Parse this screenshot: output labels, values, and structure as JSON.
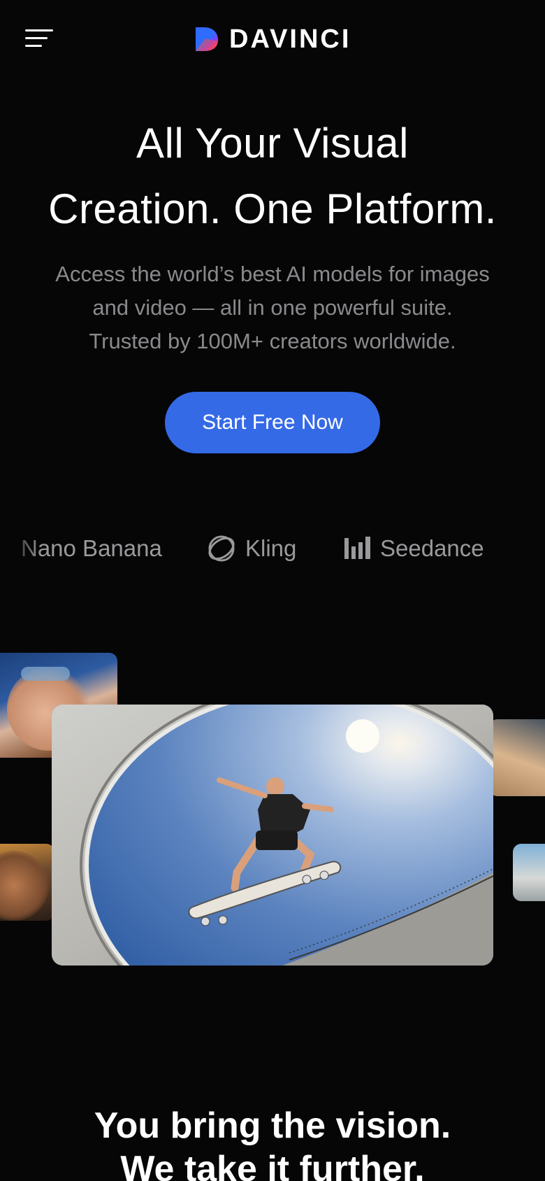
{
  "header": {
    "menu_icon": "hamburger-menu-icon",
    "logo_icon": "davinci-logo-icon",
    "logo_text": "DAVINCI"
  },
  "hero": {
    "title_line1": "All Your Visual",
    "title_line2": "Creation. One Platform.",
    "subtitle_line1": "Access the world’s best AI models for images",
    "subtitle_line2": "and video — all in one powerful suite.",
    "subtitle_line3": "Trusted by 100M+ creators worldwide.",
    "cta_label": "Start Free Now"
  },
  "models": [
    {
      "name": "Nano Banana",
      "icon": null
    },
    {
      "name": "Kling",
      "icon": "kling-logo-icon"
    },
    {
      "name": "Seedance",
      "icon": "seedance-bars-icon"
    }
  ],
  "gallery": {
    "main_image": "skateboarder-in-bowl-photo",
    "side_images": [
      "woman-sunglasses-photo",
      "man-laughing-photo",
      "woman-field-photo",
      "landscape-photo"
    ]
  },
  "section": {
    "title_line1": "You bring the vision.",
    "title_line2": "We take it further."
  },
  "colors": {
    "background": "#060607",
    "accent": "#356ae6",
    "muted_text": "#8a8a8d"
  }
}
